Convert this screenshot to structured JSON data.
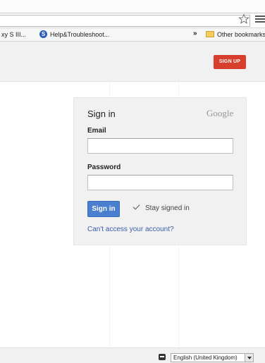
{
  "browser": {
    "bookmarks": [
      {
        "label": "xy S III..."
      },
      {
        "badge": "S",
        "label": "Help&Troubleshoot..."
      },
      {
        "label": "Other bookmarks"
      }
    ],
    "overflow_label": "»"
  },
  "header": {
    "signup_label": "SIGN UP"
  },
  "signin_card": {
    "title": "Sign in",
    "brand": "Google",
    "email_label": "Email",
    "email_value": "",
    "password_label": "Password",
    "password_value": "",
    "signin_button": "Sign in",
    "stay_signed_in": "Stay signed in",
    "stay_signed_in_checked": true,
    "cant_access_link": "Can't access your account?"
  },
  "footer": {
    "language_selected": "English (United Kingdom)"
  },
  "colors": {
    "signup_red": "#d73f2c",
    "signin_blue": "#4a7ecf",
    "link_blue": "#3b5ea8",
    "card_gray": "#f1f1f1"
  },
  "icons": [
    "star-icon",
    "chrome-menu-icon",
    "folder-icon",
    "check-icon",
    "chat-icon",
    "dropdown-arrow-icon"
  ]
}
